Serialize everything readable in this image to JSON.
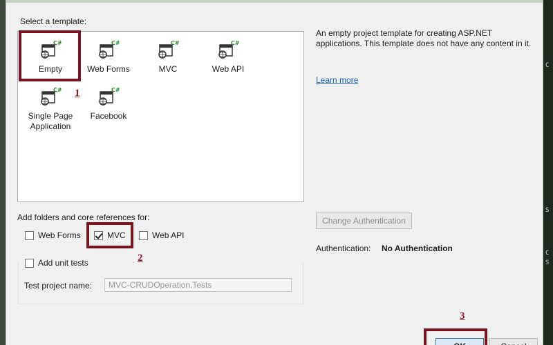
{
  "dialog": {
    "select_template_label": "Select a template:",
    "templates": [
      {
        "name": "Empty",
        "label": "Empty"
      },
      {
        "name": "web-forms",
        "label": "Web Forms"
      },
      {
        "name": "mvc",
        "label": "MVC"
      },
      {
        "name": "web-api",
        "label": "Web API"
      },
      {
        "name": "single-page-application",
        "label": "Single Page Application"
      },
      {
        "name": "facebook",
        "label": "Facebook"
      }
    ],
    "icon_badge": "C#",
    "description": "An empty project template for creating ASP.NET applications. This template does not have any content in it.",
    "learn_more": "Learn more",
    "add_folders_label": "Add folders and core references for:",
    "folders": {
      "web_forms": {
        "label": "Web Forms",
        "checked": false
      },
      "mvc": {
        "label": "MVC",
        "checked": true
      },
      "web_api": {
        "label": "Web API",
        "checked": false
      }
    },
    "unit_tests": {
      "label": "Add unit tests",
      "checked": false
    },
    "test_project_label": "Test project name:",
    "test_project_value": "MVC-CRUDOperation.Tests",
    "change_auth_button": "Change Authentication",
    "authentication_label": "Authentication:",
    "authentication_value": "No Authentication",
    "ok_button": "OK",
    "cancel_button": "Cancel"
  },
  "annotations": {
    "step1": "1",
    "step2": "2",
    "step3": "3",
    "highlight_color": "#7a1420"
  },
  "side_strip": [
    "C",
    "S",
    "C",
    "S"
  ]
}
